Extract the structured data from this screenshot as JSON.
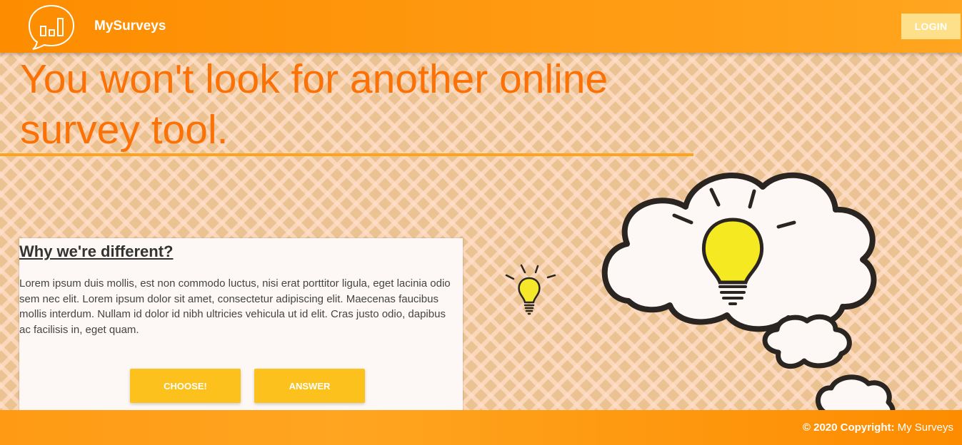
{
  "header": {
    "brand": "MySurveys",
    "logo_icon": "chart-speech-bubble-icon",
    "login_label": "LOGIN"
  },
  "hero": {
    "title": "You won't look for another online survey tool."
  },
  "card": {
    "title": "Why we're different?",
    "text": "Lorem ipsum duis mollis, est non commodo luctus, nisi erat porttitor ligula, eget lacinia odio sem nec elit. Lorem ipsum dolor sit amet, consectetur adipiscing elit. Maecenas faucibus mollis interdum. Nullam id dolor id nibh ultricies vehicula ut id elit. Cras justo odio, dapibus ac facilisis in, eget quam.",
    "choose_label": "CHOOSE!",
    "answer_label": "ANSWER"
  },
  "footer": {
    "copyright_label": "© 2020 Copyright:",
    "copyright_name": "My Surveys"
  },
  "colors": {
    "accent": "#fd8c00",
    "title": "#fb7106",
    "button": "#fdc11e",
    "login": "#ffe08a",
    "background": "#ebc393"
  },
  "illustrations": [
    "lightbulb-icon",
    "thought-cloud-lightbulb-icon"
  ]
}
